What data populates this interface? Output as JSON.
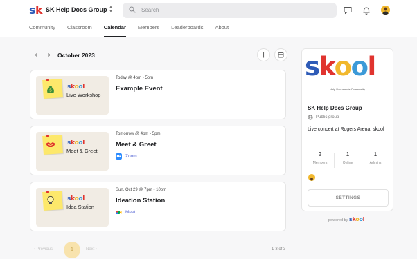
{
  "header": {
    "logo_text": "sk",
    "group_name": "SK Help Docs Group",
    "search_placeholder": "Search"
  },
  "tabs": [
    "Community",
    "Classroom",
    "Calendar",
    "Members",
    "Leaderboards",
    "About"
  ],
  "active_tab": "Calendar",
  "calendar": {
    "month": "October 2023",
    "prev_icon": "chevron-left-icon",
    "next_icon": "chevron-right-icon"
  },
  "events": [
    {
      "thumb_brand": "skool",
      "thumb_label": "Live Workshop",
      "thumb_icon": "money-bag-icon",
      "time": "Today @ 4pm - 5pm",
      "title": "Example Event",
      "location": ""
    },
    {
      "thumb_brand": "skool",
      "thumb_label": "Meet & Greet",
      "thumb_icon": "handshake-icon",
      "time": "Tomorrow @ 4pm - 5pm",
      "title": "Meet & Greet",
      "location": "Zoom"
    },
    {
      "thumb_brand": "skool",
      "thumb_label": "Idea Station",
      "thumb_icon": "lightbulb-icon",
      "time": "Sun, Oct 29 @ 7pm - 10pm",
      "title": "Ideation Station",
      "location": "Meet"
    }
  ],
  "pagination": {
    "previous": "Previous",
    "current": "1",
    "next": "Next",
    "count": "1-3 of 3"
  },
  "about": {
    "cover_logo": "skool",
    "cover_tagline": "Help Documents Community",
    "name": "SK Help Docs Group",
    "privacy": "Public group",
    "description": "Live concert at Rogers Arena, skool",
    "stats": [
      {
        "value": "2",
        "label": "Members"
      },
      {
        "value": "1",
        "label": "Online"
      },
      {
        "value": "1",
        "label": "Admins"
      }
    ],
    "settings_label": "SETTINGS"
  },
  "footer": {
    "powered_by": "powered by",
    "brand": "skool"
  },
  "colors": {
    "skool_s": "#2e5bb7",
    "skool_k": "#e0342f",
    "skool_o1": "#f1b82d",
    "skool_o2": "#3c9ad8",
    "skool_l": "#e0342f",
    "accent_page": "#f8e3ad"
  }
}
